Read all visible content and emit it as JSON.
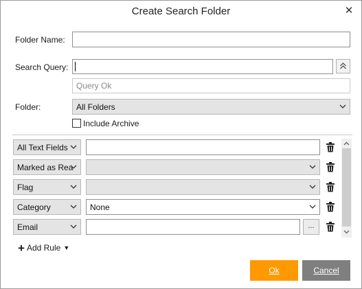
{
  "dialog": {
    "title": "Create Search Folder",
    "close_icon": "close-icon"
  },
  "form": {
    "folder_name": {
      "label": "Folder Name:",
      "value": ""
    },
    "search_query": {
      "label": "Search Query:",
      "value": "",
      "status": "Query Ok"
    },
    "folder": {
      "label": "Folder:",
      "selected": "All Folders"
    },
    "include_archive": {
      "label": "Include Archive",
      "checked": false
    }
  },
  "rules": [
    {
      "field": "All Text Fields",
      "value": "",
      "value_type": "text"
    },
    {
      "field": "Marked as Rea",
      "value": "",
      "value_type": "select"
    },
    {
      "field": "Flag",
      "value": "",
      "value_type": "select"
    },
    {
      "field": "Category",
      "value": "None",
      "value_type": "select"
    },
    {
      "field": "Email",
      "value": "",
      "value_type": "text-with-browse",
      "browse_label": "..."
    }
  ],
  "add_rule": {
    "label": "Add Rule"
  },
  "buttons": {
    "ok": "Ok",
    "cancel": "Cancel"
  },
  "colors": {
    "ok_bg": "#ff9900",
    "cancel_bg": "#7f7f7f"
  }
}
